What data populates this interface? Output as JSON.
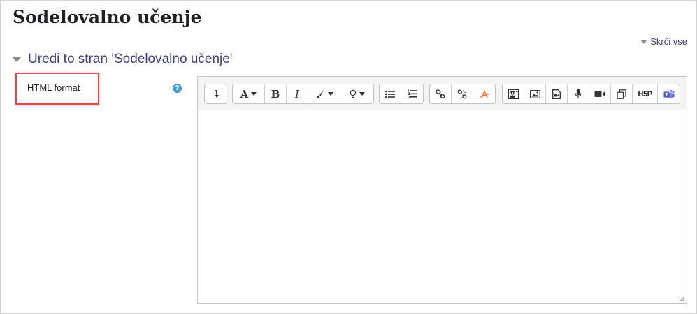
{
  "page": {
    "title": "Sodelovalno učenje",
    "collapse_all": "Skrči vse"
  },
  "section": {
    "title": "Uredi to stran 'Sodelovalno učenje'"
  },
  "field": {
    "label": "HTML format",
    "help_glyph": "?"
  },
  "toolbar": {
    "font_glyph": "A",
    "bold_glyph": "B",
    "italic_glyph": "I",
    "h5p_label": "H5P",
    "record_icon_letter": "W",
    "groups": [
      [
        "collapse-toolbar-icon"
      ],
      [
        "font-family-icon",
        "bold-icon",
        "italic-icon",
        "text-color-icon",
        "highlight-icon"
      ],
      [
        "bullet-list-icon",
        "numbered-list-icon"
      ],
      [
        "link-icon",
        "unlink-icon",
        "clear-formatting-icon"
      ],
      [
        "word-import-icon",
        "image-icon",
        "media-file-icon",
        "audio-record-icon",
        "video-record-icon",
        "copy-icon",
        "h5p-icon",
        "teams-icon"
      ]
    ]
  },
  "colors": {
    "accent": "#3c3f77",
    "highlight_border": "#e24a4a",
    "help_icon": "#3fa0d8",
    "clear_formatting": "#e97d3a",
    "teams": "#5059c9"
  }
}
